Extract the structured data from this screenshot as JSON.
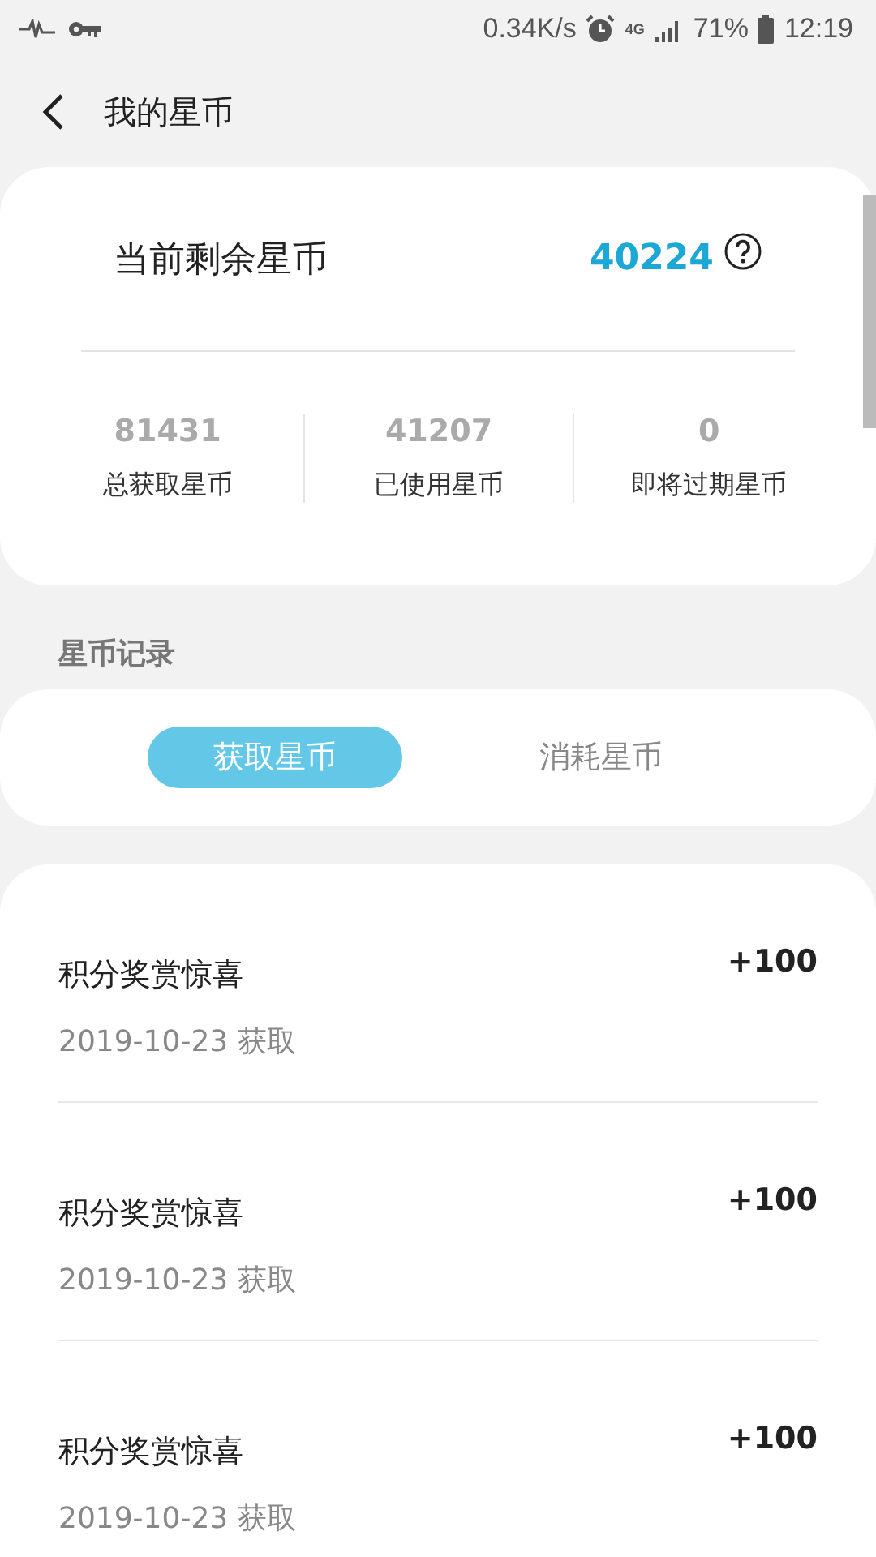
{
  "status_bar": {
    "speed": "0.34K/s",
    "network": "4G",
    "battery": "71%",
    "time": "12:19"
  },
  "header": {
    "title": "我的星币"
  },
  "balance": {
    "label": "当前剩余星币",
    "value": "40224",
    "stats": [
      {
        "value": "81431",
        "label": "总获取星币"
      },
      {
        "value": "41207",
        "label": "已使用星币"
      },
      {
        "value": "0",
        "label": "即将过期星币"
      }
    ]
  },
  "section_title": "星币记录",
  "tabs": [
    {
      "label": "获取星币",
      "selected": true
    },
    {
      "label": "消耗星币",
      "selected": false
    }
  ],
  "records": [
    {
      "title": "积分奖赏惊喜",
      "date": "2019-10-23 获取",
      "amount": "+100"
    },
    {
      "title": "积分奖赏惊喜",
      "date": "2019-10-23 获取",
      "amount": "+100"
    },
    {
      "title": "积分奖赏惊喜",
      "date": "2019-10-23 获取",
      "amount": "+100"
    }
  ]
}
